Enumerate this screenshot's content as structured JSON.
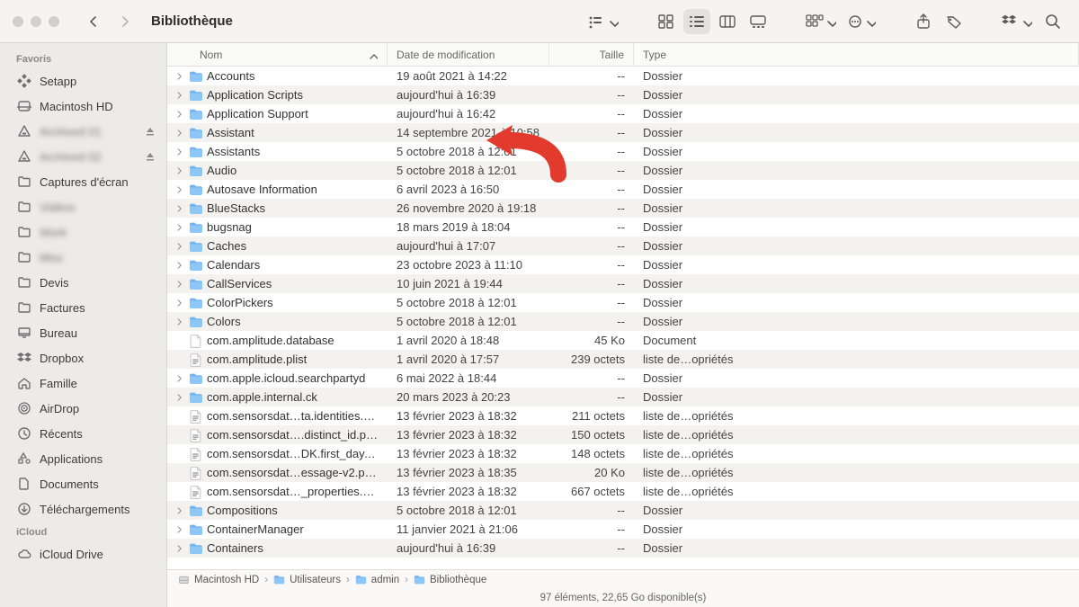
{
  "window": {
    "title": "Bibliothèque"
  },
  "sidebar": {
    "sections": [
      {
        "header": "Favoris",
        "items": [
          {
            "icon": "setapp",
            "label": "Setapp"
          },
          {
            "icon": "disk",
            "label": "Macintosh HD"
          },
          {
            "icon": "triangle",
            "label": "Archived 01",
            "blurred": true,
            "eject": true
          },
          {
            "icon": "triangle",
            "label": "Archived 02",
            "blurred": true,
            "eject": true
          },
          {
            "icon": "folder",
            "label": "Captures d'écran"
          },
          {
            "icon": "folder",
            "label": "Vidéos",
            "blurred": true
          },
          {
            "icon": "folder",
            "label": "Work",
            "blurred": true
          },
          {
            "icon": "folder",
            "label": "Misc",
            "blurred": true
          },
          {
            "icon": "folder",
            "label": "Devis"
          },
          {
            "icon": "folder",
            "label": "Factures"
          },
          {
            "icon": "desktop",
            "label": "Bureau"
          },
          {
            "icon": "dropbox",
            "label": "Dropbox"
          },
          {
            "icon": "house",
            "label": "Famille"
          },
          {
            "icon": "airdrop",
            "label": "AirDrop"
          },
          {
            "icon": "clock",
            "label": "Récents"
          },
          {
            "icon": "apps",
            "label": "Applications"
          },
          {
            "icon": "doc",
            "label": "Documents"
          },
          {
            "icon": "download",
            "label": "Téléchargements"
          }
        ]
      },
      {
        "header": "iCloud",
        "items": [
          {
            "icon": "cloud",
            "label": "iCloud Drive"
          }
        ]
      }
    ]
  },
  "columns": {
    "name": "Nom",
    "date": "Date de modification",
    "size": "Taille",
    "type": "Type"
  },
  "rows": [
    {
      "kind": "folder",
      "expandable": true,
      "name": "Accounts",
      "date": "19 août 2021 à 14:22",
      "size": "--",
      "type": "Dossier"
    },
    {
      "kind": "folder",
      "expandable": true,
      "name": "Application Scripts",
      "date": "aujourd'hui à 16:39",
      "size": "--",
      "type": "Dossier"
    },
    {
      "kind": "folder",
      "expandable": true,
      "name": "Application Support",
      "date": "aujourd'hui à 16:42",
      "size": "--",
      "type": "Dossier"
    },
    {
      "kind": "folder",
      "expandable": true,
      "name": "Assistant",
      "date": "14 septembre 2021 à 10:58",
      "size": "--",
      "type": "Dossier"
    },
    {
      "kind": "folder",
      "expandable": true,
      "name": "Assistants",
      "date": "5 octobre 2018 à 12:01",
      "size": "--",
      "type": "Dossier"
    },
    {
      "kind": "folder",
      "expandable": true,
      "name": "Audio",
      "date": "5 octobre 2018 à 12:01",
      "size": "--",
      "type": "Dossier"
    },
    {
      "kind": "folder",
      "expandable": true,
      "name": "Autosave Information",
      "date": "6 avril 2023 à 16:50",
      "size": "--",
      "type": "Dossier"
    },
    {
      "kind": "folder",
      "expandable": true,
      "name": "BlueStacks",
      "date": "26 novembre 2020 à 19:18",
      "size": "--",
      "type": "Dossier"
    },
    {
      "kind": "folder",
      "expandable": true,
      "name": "bugsnag",
      "date": "18 mars 2019 à 18:04",
      "size": "--",
      "type": "Dossier"
    },
    {
      "kind": "folder",
      "expandable": true,
      "name": "Caches",
      "date": "aujourd'hui à 17:07",
      "size": "--",
      "type": "Dossier"
    },
    {
      "kind": "folder",
      "expandable": true,
      "name": "Calendars",
      "date": "23 octobre 2023 à 11:10",
      "size": "--",
      "type": "Dossier"
    },
    {
      "kind": "folder",
      "expandable": true,
      "name": "CallServices",
      "date": "10 juin 2021 à 19:44",
      "size": "--",
      "type": "Dossier"
    },
    {
      "kind": "folder",
      "expandable": true,
      "name": "ColorPickers",
      "date": "5 octobre 2018 à 12:01",
      "size": "--",
      "type": "Dossier"
    },
    {
      "kind": "folder",
      "expandable": true,
      "name": "Colors",
      "date": "5 octobre 2018 à 12:01",
      "size": "--",
      "type": "Dossier"
    },
    {
      "kind": "file",
      "expandable": false,
      "name": "com.amplitude.database",
      "date": "1 avril 2020 à 18:48",
      "size": "45 Ko",
      "type": "Document"
    },
    {
      "kind": "plist",
      "expandable": false,
      "name": "com.amplitude.plist",
      "date": "1 avril 2020 à 17:57",
      "size": "239 octets",
      "type": "liste de…opriétés"
    },
    {
      "kind": "folder",
      "expandable": true,
      "name": "com.apple.icloud.searchpartyd",
      "date": "6 mai 2022 à 18:44",
      "size": "--",
      "type": "Dossier"
    },
    {
      "kind": "folder",
      "expandable": true,
      "name": "com.apple.internal.ck",
      "date": "20 mars 2023 à 20:23",
      "size": "--",
      "type": "Dossier"
    },
    {
      "kind": "plist",
      "expandable": false,
      "name": "com.sensorsdat…ta.identities.plist",
      "date": "13 février 2023 à 18:32",
      "size": "211 octets",
      "type": "liste de…opriétés"
    },
    {
      "kind": "plist",
      "expandable": false,
      "name": "com.sensorsdat….distinct_id.plist",
      "date": "13 février 2023 à 18:32",
      "size": "150 octets",
      "type": "liste de…opriétés"
    },
    {
      "kind": "plist",
      "expandable": false,
      "name": "com.sensorsdat…DK.first_day.plist",
      "date": "13 février 2023 à 18:32",
      "size": "148 octets",
      "type": "liste de…opriétés"
    },
    {
      "kind": "plist",
      "expandable": false,
      "name": "com.sensorsdat…essage-v2.plist",
      "date": "13 février 2023 à 18:35",
      "size": "20 Ko",
      "type": "liste de…opriétés"
    },
    {
      "kind": "plist",
      "expandable": false,
      "name": "com.sensorsdat…_properties.plist",
      "date": "13 février 2023 à 18:32",
      "size": "667 octets",
      "type": "liste de…opriétés"
    },
    {
      "kind": "folder",
      "expandable": true,
      "name": "Compositions",
      "date": "5 octobre 2018 à 12:01",
      "size": "--",
      "type": "Dossier"
    },
    {
      "kind": "folder",
      "expandable": true,
      "name": "ContainerManager",
      "date": "11 janvier 2021 à 21:06",
      "size": "--",
      "type": "Dossier"
    },
    {
      "kind": "folder",
      "expandable": true,
      "name": "Containers",
      "date": "aujourd'hui à 16:39",
      "size": "--",
      "type": "Dossier"
    }
  ],
  "path": [
    {
      "icon": "disk",
      "label": "Macintosh HD"
    },
    {
      "icon": "folder",
      "label": "Utilisateurs"
    },
    {
      "icon": "folder",
      "label": "admin"
    },
    {
      "icon": "folder",
      "label": "Bibliothèque"
    }
  ],
  "status": "97 éléments, 22,65 Go disponible(s)"
}
